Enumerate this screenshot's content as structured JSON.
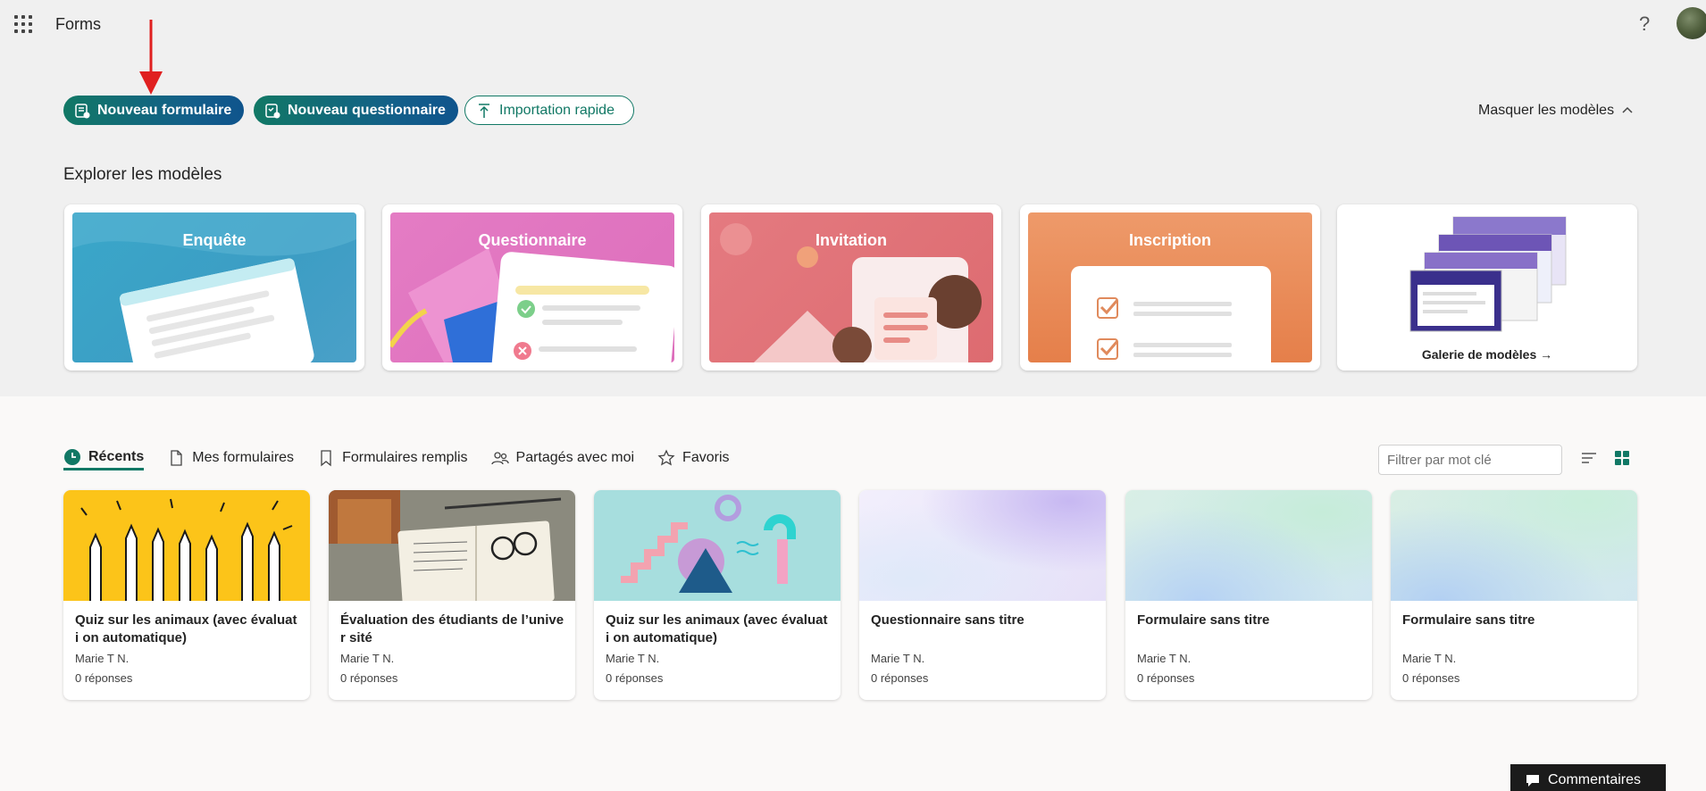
{
  "header": {
    "app_title": "Forms",
    "help_label": "?"
  },
  "actions": {
    "new_form": "Nouveau formulaire",
    "new_quiz": "Nouveau questionnaire",
    "quick_import": "Importation rapide",
    "hide_templates": "Masquer les modèles"
  },
  "templates": {
    "section_title": "Explorer les modèles",
    "items": [
      {
        "label": "Enquête",
        "icon": "survey-illustration"
      },
      {
        "label": "Questionnaire",
        "icon": "quiz-illustration"
      },
      {
        "label": "Invitation",
        "icon": "invitation-illustration"
      },
      {
        "label": "Inscription",
        "icon": "registration-illustration"
      }
    ],
    "gallery_label": "Galerie de modèles"
  },
  "tabs": [
    {
      "label": "Récents",
      "icon": "clock-icon",
      "active": true
    },
    {
      "label": "Mes formulaires",
      "icon": "document-icon",
      "active": false
    },
    {
      "label": "Formulaires remplis",
      "icon": "bookmark-icon",
      "active": false
    },
    {
      "label": "Partagés avec moi",
      "icon": "people-icon",
      "active": false
    },
    {
      "label": "Favoris",
      "icon": "star-icon",
      "active": false
    }
  ],
  "filter": {
    "placeholder": "Filtrer par mot clé"
  },
  "recent_forms": [
    {
      "title": "Quiz sur les animaux (avec évaluati on automatique)",
      "owner": "Marie T N.",
      "responses": "0 réponses"
    },
    {
      "title": "Évaluation des étudiants de l’univer sité",
      "owner": "Marie T N.",
      "responses": "0 réponses"
    },
    {
      "title": "Quiz sur les animaux (avec évaluati on automatique)",
      "owner": "Marie T N.",
      "responses": "0 réponses"
    },
    {
      "title": "Questionnaire sans titre",
      "owner": "Marie T N.",
      "responses": "0 réponses"
    },
    {
      "title": "Formulaire sans titre",
      "owner": "Marie T N.",
      "responses": "0 réponses"
    },
    {
      "title": "Formulaire sans titre",
      "owner": "Marie T N.",
      "responses": "0 réponses"
    }
  ],
  "feedback": {
    "label": "Commentaires"
  },
  "colors": {
    "accent": "#117865",
    "accent_blue": "#0f548c",
    "arrow": "#e02020"
  }
}
